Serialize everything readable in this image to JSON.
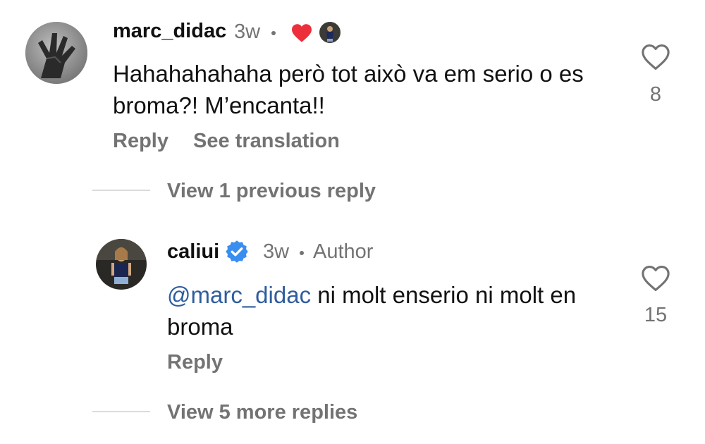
{
  "comment": {
    "username": "marc_didac",
    "age": "3w",
    "text": "Hahahahahaha però tot això va em serio o es broma?! M’encanta!!",
    "like_count": "8",
    "reply_label": "Reply",
    "translate_label": "See translation",
    "liked_by_author": true,
    "heart_color": "#ed2f3c"
  },
  "previous_replies": {
    "label": "View 1 previous reply"
  },
  "reply": {
    "username": "caliui",
    "verified": true,
    "verified_color": "#3a8ef0",
    "age": "3w",
    "author_badge": "Author",
    "mention": "@marc_didac",
    "text": " ni molt enserio ni molt en broma",
    "like_count": "15",
    "reply_label": "Reply"
  },
  "more_replies": {
    "label": "View 5 more replies"
  }
}
